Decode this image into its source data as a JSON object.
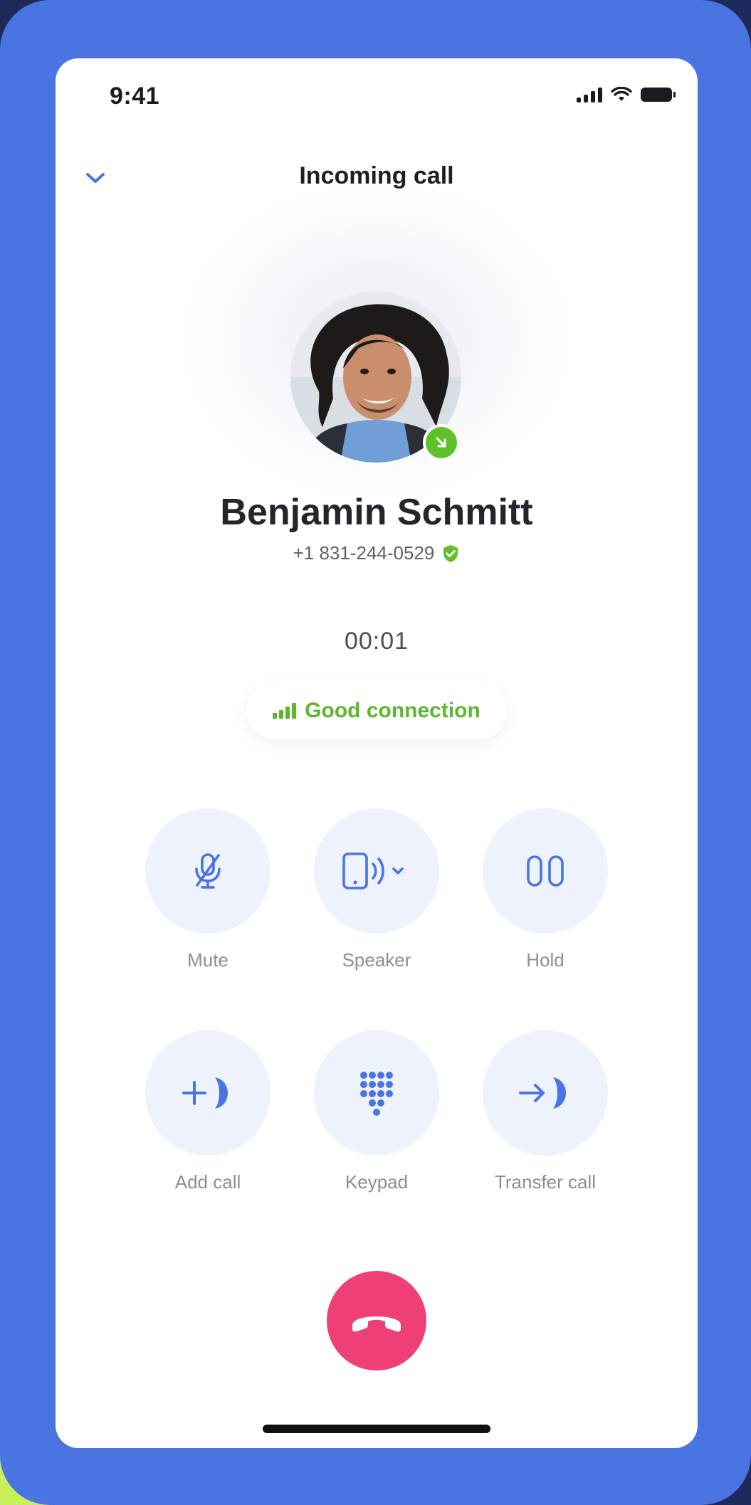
{
  "status_bar": {
    "time": "9:41"
  },
  "header": {
    "title": "Incoming call"
  },
  "contact": {
    "name": "Benjamin Schmitt",
    "phone": "+1 831-244-0529",
    "avatar": "avatar-photo"
  },
  "call": {
    "timer": "00:01",
    "connection_label": "Good connection",
    "connection_color": "#5cb82a"
  },
  "controls": [
    {
      "label": "Mute",
      "icon": "mic-off-icon"
    },
    {
      "label": "Speaker",
      "icon": "phone-speaker-icon"
    },
    {
      "label": "Hold",
      "icon": "pause-icon"
    },
    {
      "label": "Add call",
      "icon": "add-call-icon"
    },
    {
      "label": "Keypad",
      "icon": "keypad-icon"
    },
    {
      "label": "Transfer call",
      "icon": "transfer-call-icon"
    }
  ],
  "end_call": {
    "icon": "hang-up-icon",
    "color": "#ef3f77"
  },
  "colors": {
    "accent": "#4a74e2",
    "incoming_badge": "#5ec127",
    "control_bg": "#eef2fc"
  }
}
